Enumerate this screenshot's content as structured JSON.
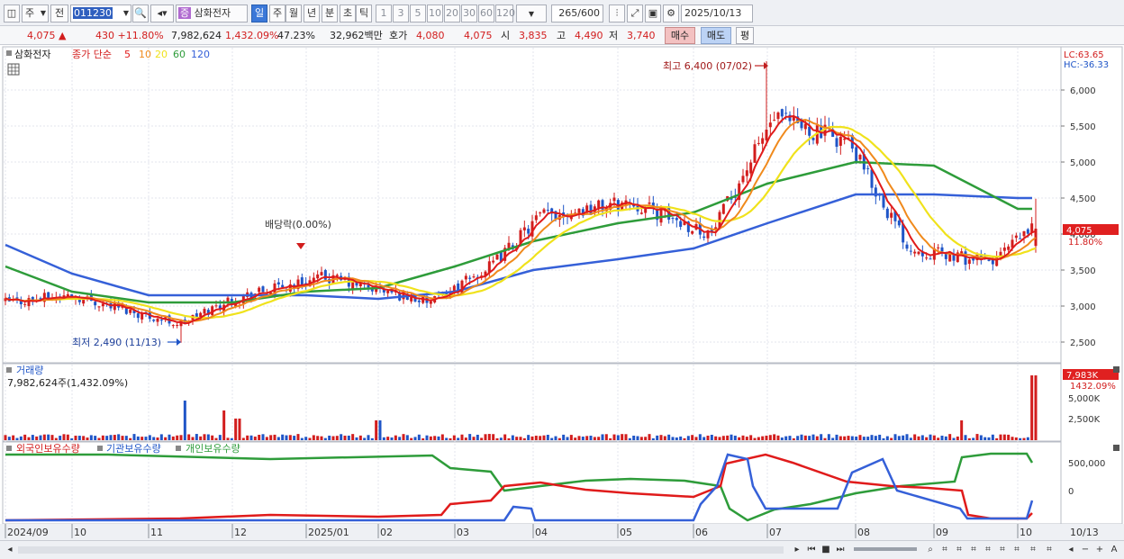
{
  "toolbar": {
    "type_select": "주",
    "prev_label": "전",
    "code": "011230",
    "name_badge": "증",
    "stock_name": "삼화전자",
    "periods": [
      "일",
      "주",
      "월",
      "년",
      "분",
      "초",
      "틱"
    ],
    "active_period": "일",
    "intervals": [
      "1",
      "3",
      "5",
      "10",
      "20",
      "30",
      "60",
      "120"
    ],
    "count": "265",
    "count_max": "/600",
    "date": "2025/10/13"
  },
  "quote": {
    "price": "4,075 ▲",
    "change": "430 +11.80%",
    "volume": "7,982,624",
    "volume_rate": "1,432.09%",
    "turnover": "47.23%",
    "amount": "32,962백만",
    "hoga_label": "호가",
    "hoga_ask": "4,080",
    "hoga_bid": "4,075",
    "open_label": "시",
    "open": "3,835",
    "high_label": "고",
    "high": "4,490",
    "low_label": "저",
    "low": "3,740",
    "buy": "매수",
    "sell": "매도",
    "avg": "평"
  },
  "legend": {
    "name": "삼화전자",
    "close": "종가 단순",
    "ma": [
      "5",
      "10",
      "20",
      "60",
      "120"
    ]
  },
  "price_axis": {
    "lc": "LC:63.65",
    "hc": "HC:-36.33",
    "ticks": [
      "6,000",
      "5,500",
      "5,000",
      "4,500",
      "4,000",
      "3,500",
      "3,000",
      "2,500"
    ],
    "current": "4,075",
    "current_pct": "11.80%"
  },
  "annotations": {
    "high": "최고 6,400 (07/02)",
    "low": "최저 2,490 (11/13)",
    "dividend": "배당락(0.00%)"
  },
  "volume_panel": {
    "title": "거래량",
    "value": "7,982,624주(1,432.09%)",
    "ticks": [
      "5,000K",
      "2,500K"
    ],
    "current": "7,983K",
    "current_pct": "1432.09%"
  },
  "holding_panel": {
    "foreign": "외국인보유수량",
    "inst": "기관보유수량",
    "indiv": "개인보유수량",
    "ticks": [
      "500,000",
      "0"
    ]
  },
  "time_axis": {
    "labels": [
      "2024/09",
      "10",
      "11",
      "12",
      "2025/01",
      "02",
      "03",
      "04",
      "05",
      "06",
      "07",
      "08",
      "09",
      "10"
    ],
    "end_label": "10/13"
  },
  "colors": {
    "up": "#d21d1d",
    "down": "#1f55c7",
    "ma5": "#e01b1b",
    "ma10": "#f08a1c",
    "ma20": "#f0e21c",
    "ma60": "#2e9c3a",
    "ma120": "#3560d8"
  },
  "chart_data": {
    "type": "candlestick",
    "x": [
      "2024/09",
      "10",
      "11",
      "12",
      "2025/01",
      "02",
      "03",
      "04",
      "05",
      "06",
      "07",
      "08",
      "09",
      "10"
    ],
    "ylim": [
      2300,
      6500
    ],
    "close": [
      3050,
      3150,
      2750,
      3100,
      3400,
      3050,
      3550,
      4250,
      4450,
      4000,
      5600,
      5300,
      3800,
      3600,
      4075
    ],
    "ma60": [
      3550,
      3200,
      3050,
      3050,
      3200,
      3250,
      3550,
      3900,
      4150,
      4300,
      4700,
      5000,
      4950,
      4350
    ],
    "ma120": [
      3850,
      3450,
      3150,
      3150,
      3150,
      3100,
      3200,
      3500,
      3650,
      3800,
      4150,
      4550,
      4550,
      4500
    ]
  }
}
